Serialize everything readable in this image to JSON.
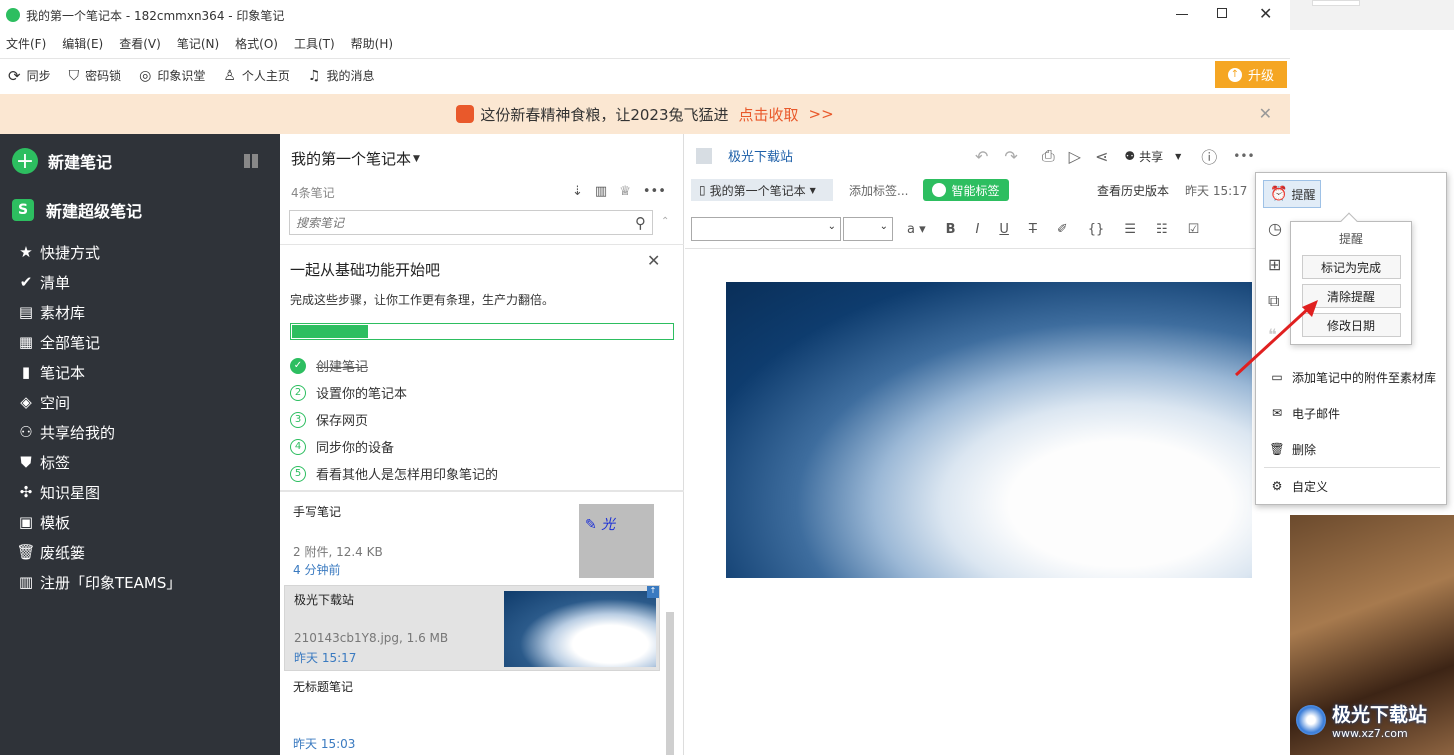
{
  "window": {
    "title": "我的第一个笔记本 - 182cmmxn364 - 印象笔记"
  },
  "menubar": [
    "文件(F)",
    "编辑(E)",
    "查看(V)",
    "笔记(N)",
    "格式(O)",
    "工具(T)",
    "帮助(H)"
  ],
  "toolbar": {
    "items": [
      {
        "icon": "sync-icon",
        "label": "同步"
      },
      {
        "icon": "lock-icon",
        "label": "密码锁"
      },
      {
        "icon": "classroom-icon",
        "label": "印象识堂"
      },
      {
        "icon": "user-icon",
        "label": "个人主页"
      },
      {
        "icon": "bell-icon",
        "label": "我的消息"
      }
    ],
    "upgrade": "升级"
  },
  "banner": {
    "text": "这份新春精神食粮，让2023兔飞猛进",
    "link": "点击收取",
    "arrows": ">>"
  },
  "sidebar": {
    "new_note": "新建笔记",
    "new_super": "新建超级笔记",
    "items": [
      {
        "icon": "star-icon",
        "label": "快捷方式"
      },
      {
        "icon": "check-icon",
        "label": "清单"
      },
      {
        "icon": "library-icon",
        "label": "素材库"
      },
      {
        "icon": "notes-icon",
        "label": "全部笔记"
      },
      {
        "icon": "notebook-icon",
        "label": "笔记本"
      },
      {
        "icon": "space-icon",
        "label": "空间"
      },
      {
        "icon": "shared-icon",
        "label": "共享给我的"
      },
      {
        "icon": "tag-icon",
        "label": "标签"
      },
      {
        "icon": "graph-icon",
        "label": "知识星图"
      },
      {
        "icon": "template-icon",
        "label": "模板"
      },
      {
        "icon": "trash-icon",
        "label": "废纸篓"
      },
      {
        "icon": "building-icon",
        "label": "注册「印象TEAMS」"
      }
    ]
  },
  "notelist": {
    "title": "我的第一个笔记本",
    "count": "4条笔记",
    "search_placeholder": "搜索笔记",
    "onboard": {
      "title": "一起从基础功能开始吧",
      "desc": "完成这些步骤，让你工作更有条理，生产力翻倍。",
      "progress": 0.2,
      "steps": [
        {
          "n": "✓",
          "label": "创建笔记",
          "done": true
        },
        {
          "n": "2",
          "label": "设置你的笔记本"
        },
        {
          "n": "3",
          "label": "保存网页"
        },
        {
          "n": "4",
          "label": "同步你的设备"
        },
        {
          "n": "5",
          "label": "看看其他人是怎样用印象笔记的"
        }
      ]
    },
    "notes": [
      {
        "title": "手写笔记",
        "meta": "2 附件, 12.4 KB",
        "time": "4 分钟前"
      },
      {
        "title": "极光下载站",
        "meta": "210143cb1Y8.jpg, 1.6 MB",
        "time": "昨天 15:17"
      },
      {
        "title": "无标题笔记",
        "meta": "",
        "time": "昨天 15:03"
      }
    ]
  },
  "editor": {
    "title": "极光下载站",
    "share": "共享",
    "notebook": "我的第一个笔记本",
    "add_tag": "添加标签...",
    "smart_tag": "智能标签",
    "history": "查看历史版本",
    "date": "昨天 15:17"
  },
  "context_menu": {
    "reminder": "提醒",
    "submenu_title": "提醒",
    "sub": [
      "标记为完成",
      "清除提醒",
      "修改日期"
    ],
    "items": [
      "添加笔记中的附件至素材库",
      "电子邮件",
      "删除",
      "自定义"
    ]
  },
  "watermark": {
    "text": "极光下载站",
    "url": "www.xz7.com"
  }
}
